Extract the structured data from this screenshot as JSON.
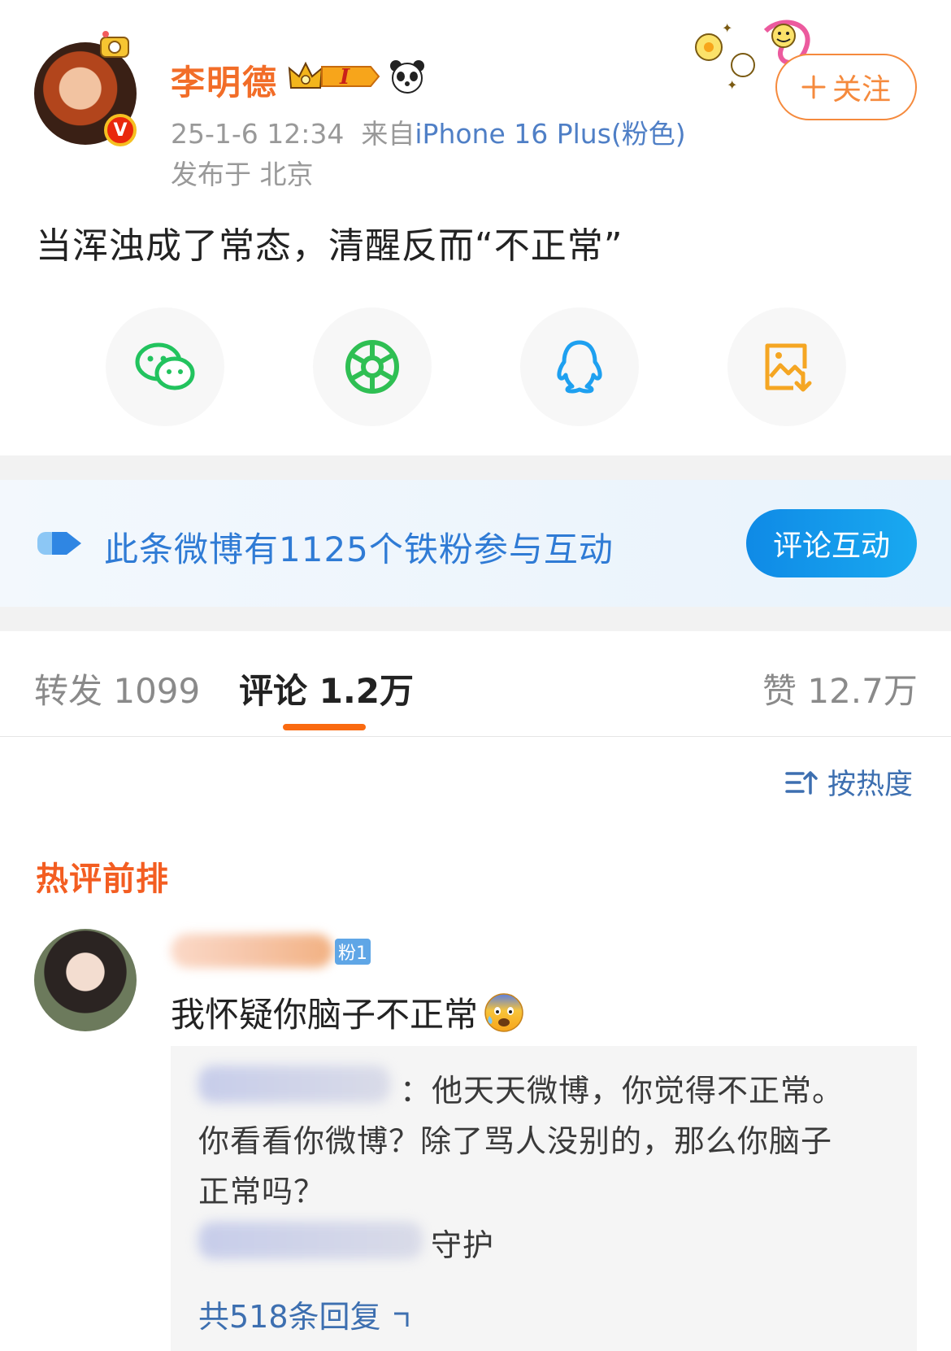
{
  "post": {
    "username": "李明德",
    "crown_level": "I",
    "timestamp": "25-1-6 12:34",
    "from_label": "来自",
    "source_device": "iPhone 16 Plus(粉色)",
    "location": "发布于 北京",
    "follow_label": "关注",
    "text": "当浑浊成了常态，清醒反而“不正常”"
  },
  "share": {
    "items": [
      {
        "icon": "wechat-icon",
        "color": "#22c35e"
      },
      {
        "icon": "moments-icon",
        "color": "#2fbf53"
      },
      {
        "icon": "qq-icon",
        "color": "#1ea0f0"
      },
      {
        "icon": "save-image-icon",
        "color": "#f5a623"
      }
    ]
  },
  "fan_banner": {
    "text": "此条微博有1125个铁粉参与互动",
    "button_label": "评论互动"
  },
  "tabs": {
    "repost": "转发 1099",
    "comments": "评论 1.2万",
    "likes": "赞 12.7万"
  },
  "sort": {
    "label": "按热度"
  },
  "hot_comments": {
    "title": "热评前排",
    "comment": {
      "fan_badge": "粉1",
      "text": "我怀疑你脑子不正常",
      "emoji": "fearful-face-emoji",
      "reply_line1": "：他天天微博，你觉得不正常。",
      "reply_line2": "你看看你微博？除了骂人没别的，那么你脑子",
      "reply_line3": "正常吗？",
      "reply_line4_suffix": "守护",
      "reply_count": "共518条回复"
    }
  },
  "colors": {
    "accent_orange": "#f26d28",
    "link_blue": "#4f7fc6",
    "banner_blue": "#2f7bd5"
  }
}
